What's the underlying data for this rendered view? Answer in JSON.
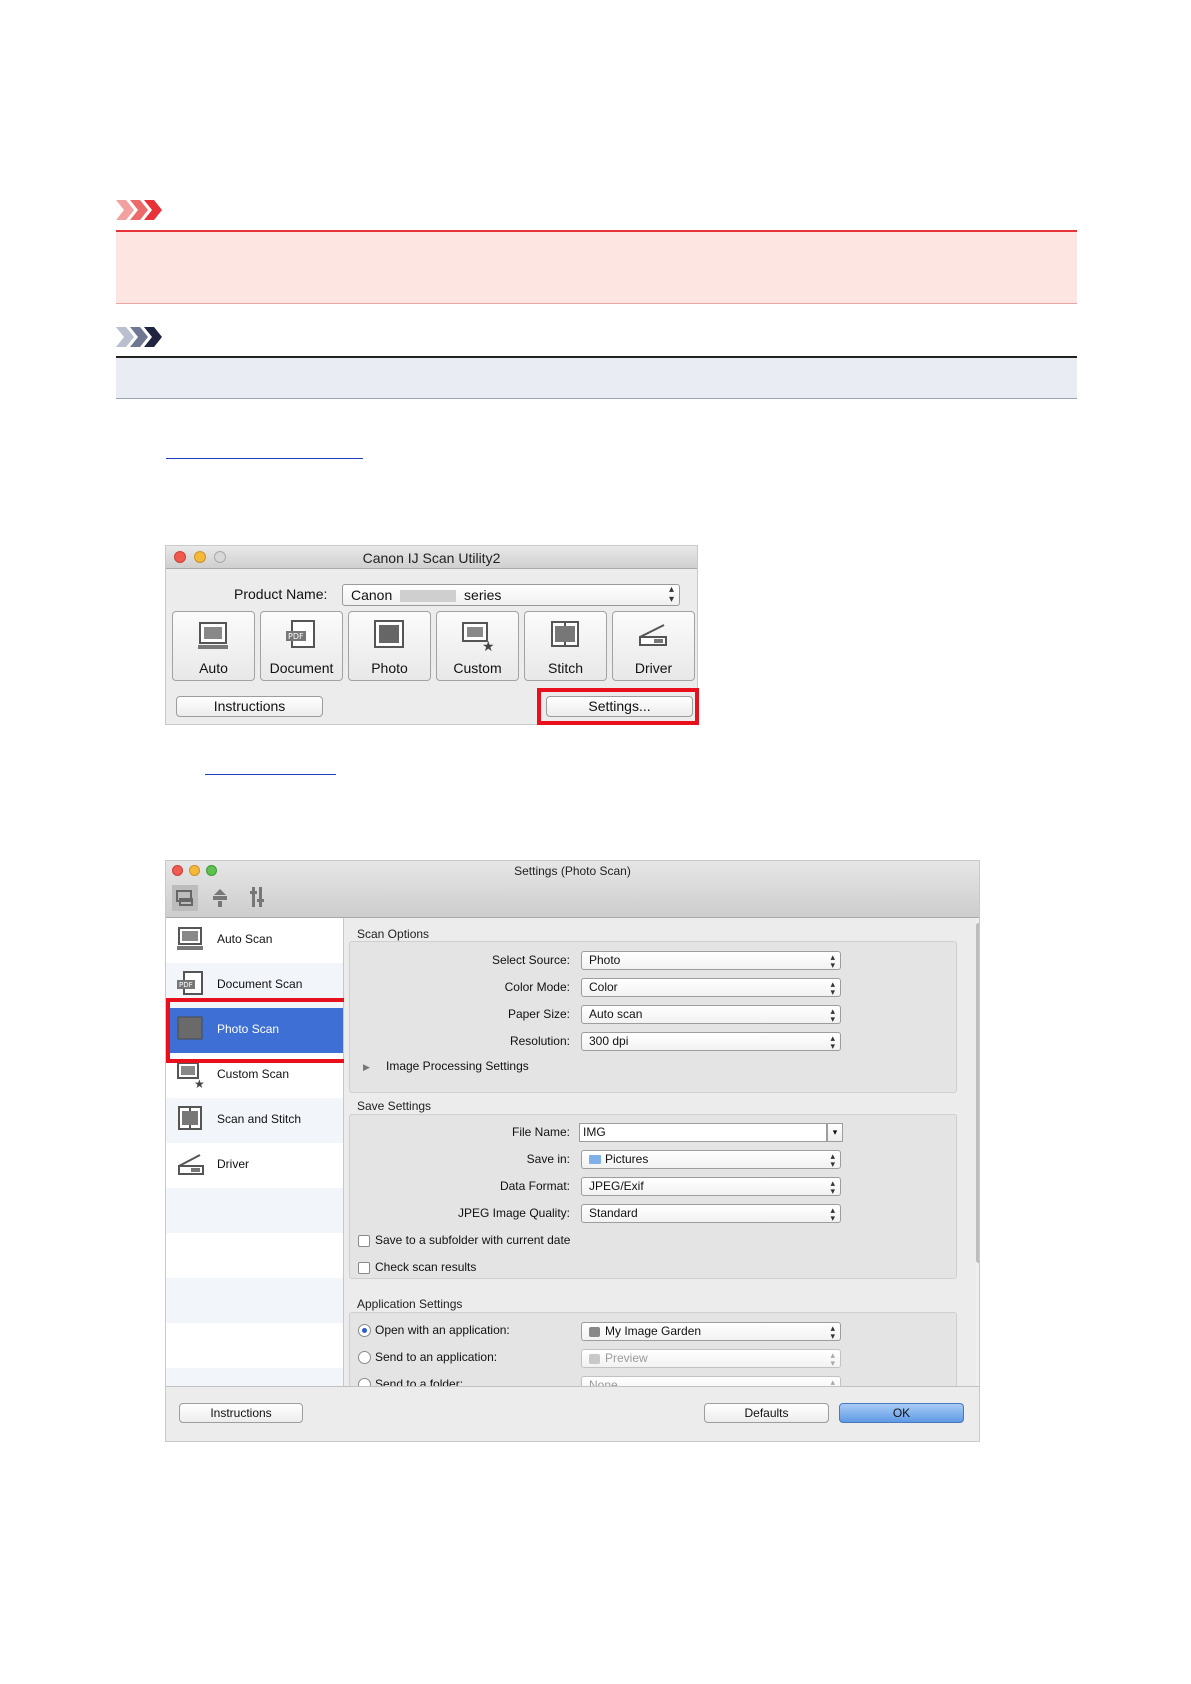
{
  "window_main": {
    "title": "Canon IJ Scan Utility2",
    "product_label": "Product Name:",
    "product_value_left": "Canon",
    "product_value_right": "series",
    "tools": [
      {
        "label": "Auto",
        "icon": "auto-scan-icon"
      },
      {
        "label": "Document",
        "icon": "document-scan-icon"
      },
      {
        "label": "Photo",
        "icon": "photo-scan-icon"
      },
      {
        "label": "Custom",
        "icon": "custom-scan-icon"
      },
      {
        "label": "Stitch",
        "icon": "stitch-scan-icon"
      },
      {
        "label": "Driver",
        "icon": "driver-icon"
      }
    ],
    "instructions_label": "Instructions",
    "settings_label": "Settings..."
  },
  "window_settings": {
    "title": "Settings (Photo Scan)",
    "sidebar": [
      {
        "label": "Auto Scan"
      },
      {
        "label": "Document Scan"
      },
      {
        "label": "Photo Scan",
        "selected": true
      },
      {
        "label": "Custom Scan"
      },
      {
        "label": "Scan and Stitch"
      },
      {
        "label": "Driver"
      }
    ],
    "scan_options": {
      "title": "Scan Options",
      "fields": [
        {
          "label": "Select Source:",
          "value": "Photo"
        },
        {
          "label": "Color Mode:",
          "value": "Color"
        },
        {
          "label": "Paper Size:",
          "value": "Auto scan"
        },
        {
          "label": "Resolution:",
          "value": "300 dpi"
        }
      ],
      "image_processing": "Image Processing Settings"
    },
    "save_settings": {
      "title": "Save Settings",
      "file_name_label": "File Name:",
      "file_name_value": "IMG",
      "save_in_label": "Save in:",
      "save_in_value": "Pictures",
      "data_format_label": "Data Format:",
      "data_format_value": "JPEG/Exif",
      "jpeg_quality_label": "JPEG Image Quality:",
      "jpeg_quality_value": "Standard",
      "subfolder_label": "Save to a subfolder with current date",
      "check_results_label": "Check scan results"
    },
    "app_settings": {
      "title": "Application Settings",
      "open_with_label": "Open with an application:",
      "open_with_value": "My Image Garden",
      "send_app_label": "Send to an application:",
      "send_app_value": "Preview",
      "send_folder_label": "Send to a folder:",
      "send_folder_value": "None"
    },
    "buttons": {
      "instructions": "Instructions",
      "defaults": "Defaults",
      "ok": "OK"
    }
  },
  "colors": {
    "important_accent": "#e8323a",
    "important_bg": "#fde6e1",
    "note_bg": "#e9ecf2",
    "highlight_red": "#e8101c",
    "selection_blue": "#3d6fd4",
    "link": "#1f3fbf"
  }
}
